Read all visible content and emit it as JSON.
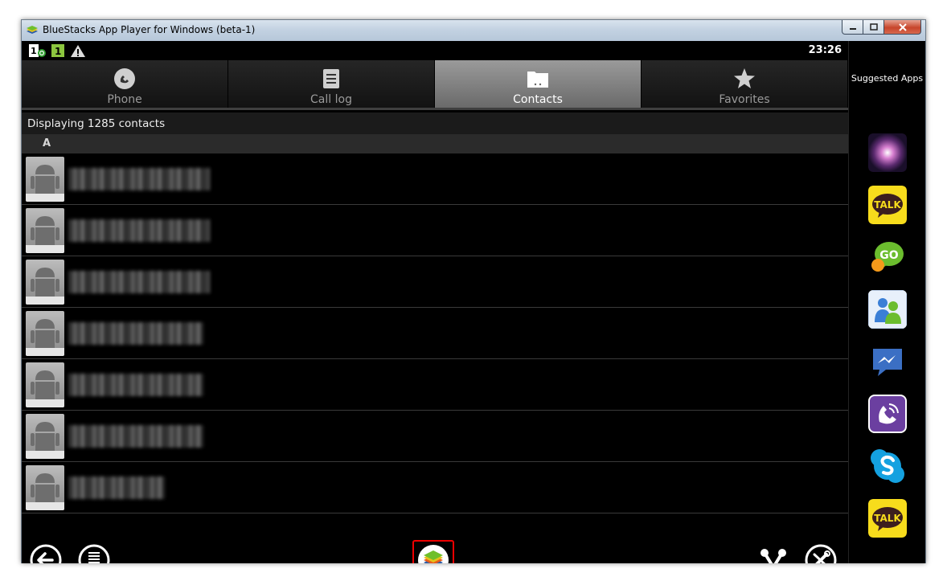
{
  "window": {
    "title": "BlueStacks App Player for Windows (beta-1)"
  },
  "statusbar": {
    "time": "23:26"
  },
  "tabs": [
    {
      "label": "Phone",
      "icon": "phone-icon",
      "selected": false
    },
    {
      "label": "Call log",
      "icon": "call-log-icon",
      "selected": false
    },
    {
      "label": "Contacts",
      "icon": "contacts-icon",
      "selected": true
    },
    {
      "label": "Favorites",
      "icon": "star-icon",
      "selected": false
    }
  ],
  "contacts": {
    "header": "Displaying 1285 contacts",
    "section_letter": "A",
    "rows": [
      {
        "name_visible": false
      },
      {
        "name_visible": false
      },
      {
        "name_visible": false
      },
      {
        "name_visible": false
      },
      {
        "name_visible": false
      },
      {
        "name_visible": false
      },
      {
        "name_visible": false
      }
    ]
  },
  "sidebar": {
    "heading": "Suggested Apps",
    "apps": [
      {
        "icon": "galaxy-app-icon",
        "color": "#5a2a6e"
      },
      {
        "icon": "kakaotalk-icon",
        "label": "TALK",
        "color": "#f7dc1c"
      },
      {
        "icon": "go-chat-icon",
        "label": "GO",
        "color": "#6bbd2e"
      },
      {
        "icon": "messenger-people-icon",
        "color": "#3b7fd6"
      },
      {
        "icon": "facebook-messenger-icon",
        "color": "#3b6fc4"
      },
      {
        "icon": "viber-icon",
        "color": "#6b3fa0"
      },
      {
        "icon": "skype-icon",
        "color": "#14a1e0"
      },
      {
        "icon": "kakaotalk-icon",
        "label": "TALK",
        "color": "#f7dc1c"
      }
    ]
  },
  "colors": {
    "selected_tab": "#8a8a8a",
    "bluestacks_highlight": "#e00000"
  }
}
